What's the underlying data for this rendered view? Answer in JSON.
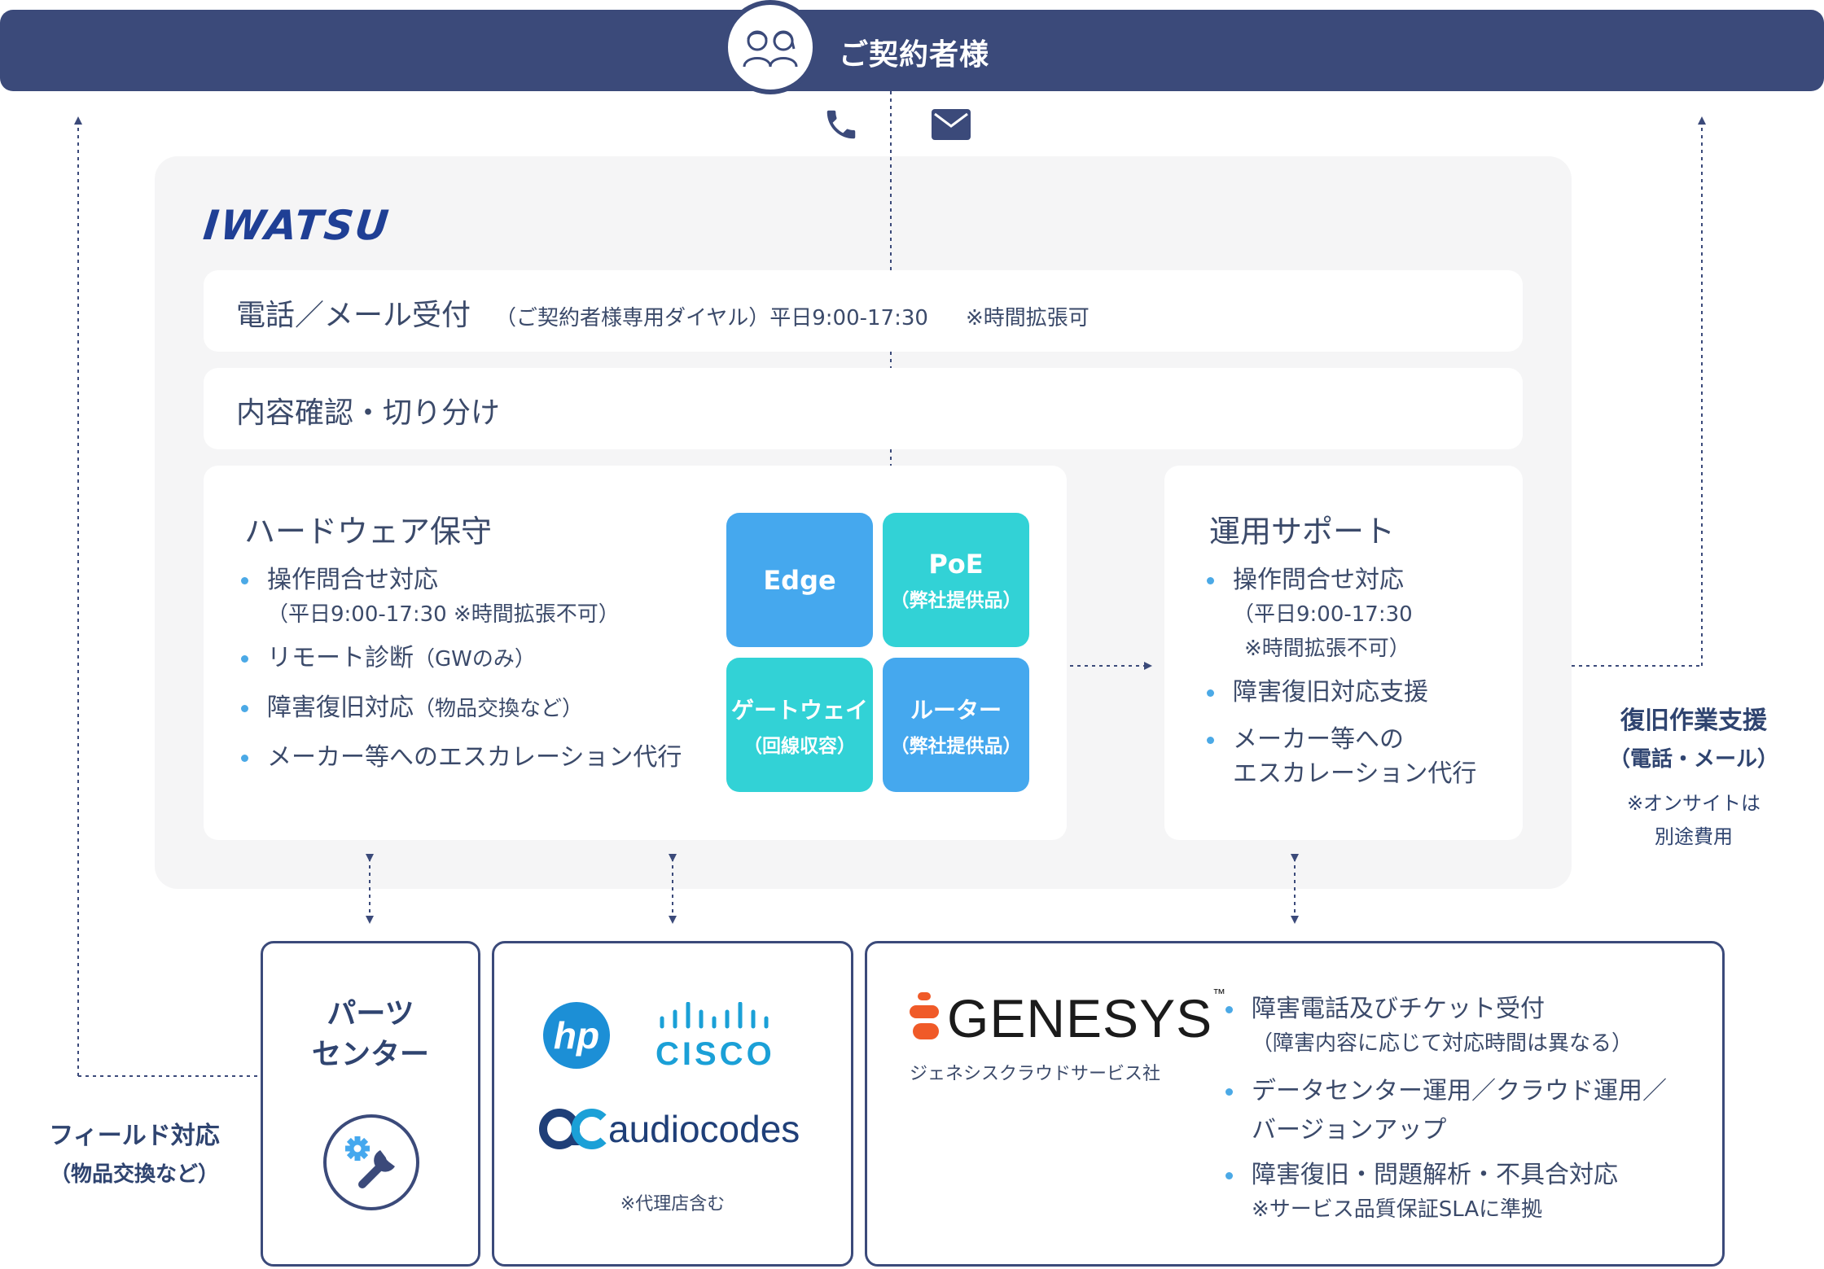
{
  "header": {
    "title": "ご契約者様"
  },
  "company": {
    "logo_text": "IWATSU"
  },
  "reception": {
    "main": "電話／メール受付",
    "detail": "（ご契約者様専用ダイヤル）平日9:00-17:30",
    "note": "※時間拡張可"
  },
  "triage": {
    "label": "内容確認・切り分け"
  },
  "hardware": {
    "title": "ハードウェア保守",
    "items": [
      {
        "text": "操作問合せ対応",
        "sub": "（平日9:00-17:30 ※時間拡張不可）"
      },
      {
        "text": "リモート診断",
        "sub": "（GWのみ）"
      },
      {
        "text": "障害復旧対応",
        "sub": "（物品交換など）"
      },
      {
        "text": "メーカー等へのエスカレーション代行"
      }
    ],
    "tiles": [
      {
        "label": "Edge",
        "sub": "",
        "color": "#45a8ee"
      },
      {
        "label": "PoE",
        "sub": "（弊社提供品）",
        "color": "#32d2d6"
      },
      {
        "label": "ゲートウェイ",
        "sub": "（回線収容）",
        "color": "#32d2d6"
      },
      {
        "label": "ルーター",
        "sub": "（弊社提供品）",
        "color": "#45a8ee"
      }
    ]
  },
  "operation": {
    "title": "運用サポート",
    "items": [
      {
        "text": "操作問合せ対応",
        "sub1": "（平日9:00-17:30",
        "sub2": "※時間拡張不可）"
      },
      {
        "text": "障害復旧対応支援"
      },
      {
        "text": "メーカー等への",
        "line2": "エスカレーション代行"
      }
    ]
  },
  "recovery": {
    "title": "復旧作業支援",
    "sub": "（電話・メール）",
    "note1": "※オンサイトは",
    "note2": "別途費用"
  },
  "field": {
    "title": "フィールド対応",
    "sub": "（物品交換など）"
  },
  "parts": {
    "line1": "パーツ",
    "line2": "センター"
  },
  "vendors": {
    "hp": "hp",
    "cisco": "CISCO",
    "audiocodes": "audiocodes",
    "note": "※代理店含む"
  },
  "genesys": {
    "logo": "GENESYS",
    "tm": "™",
    "company": "ジェネシスクラウドサービス社",
    "items": [
      {
        "text": "障害電話及びチケット受付",
        "sub": "（障害内容に応じて対応時間は異なる）"
      },
      {
        "text": "データセンター運用／クラウド運用／",
        "line2": "バージョンアップ"
      },
      {
        "text": "障害復旧・問題解析・不具合対応",
        "sub": "※サービス品質保証SLAに準拠"
      }
    ]
  },
  "colors": {
    "navy": "#3b4a7a",
    "blue": "#45a8ee",
    "cyan": "#32d2d6",
    "genesys_orange": "#f05a28"
  }
}
